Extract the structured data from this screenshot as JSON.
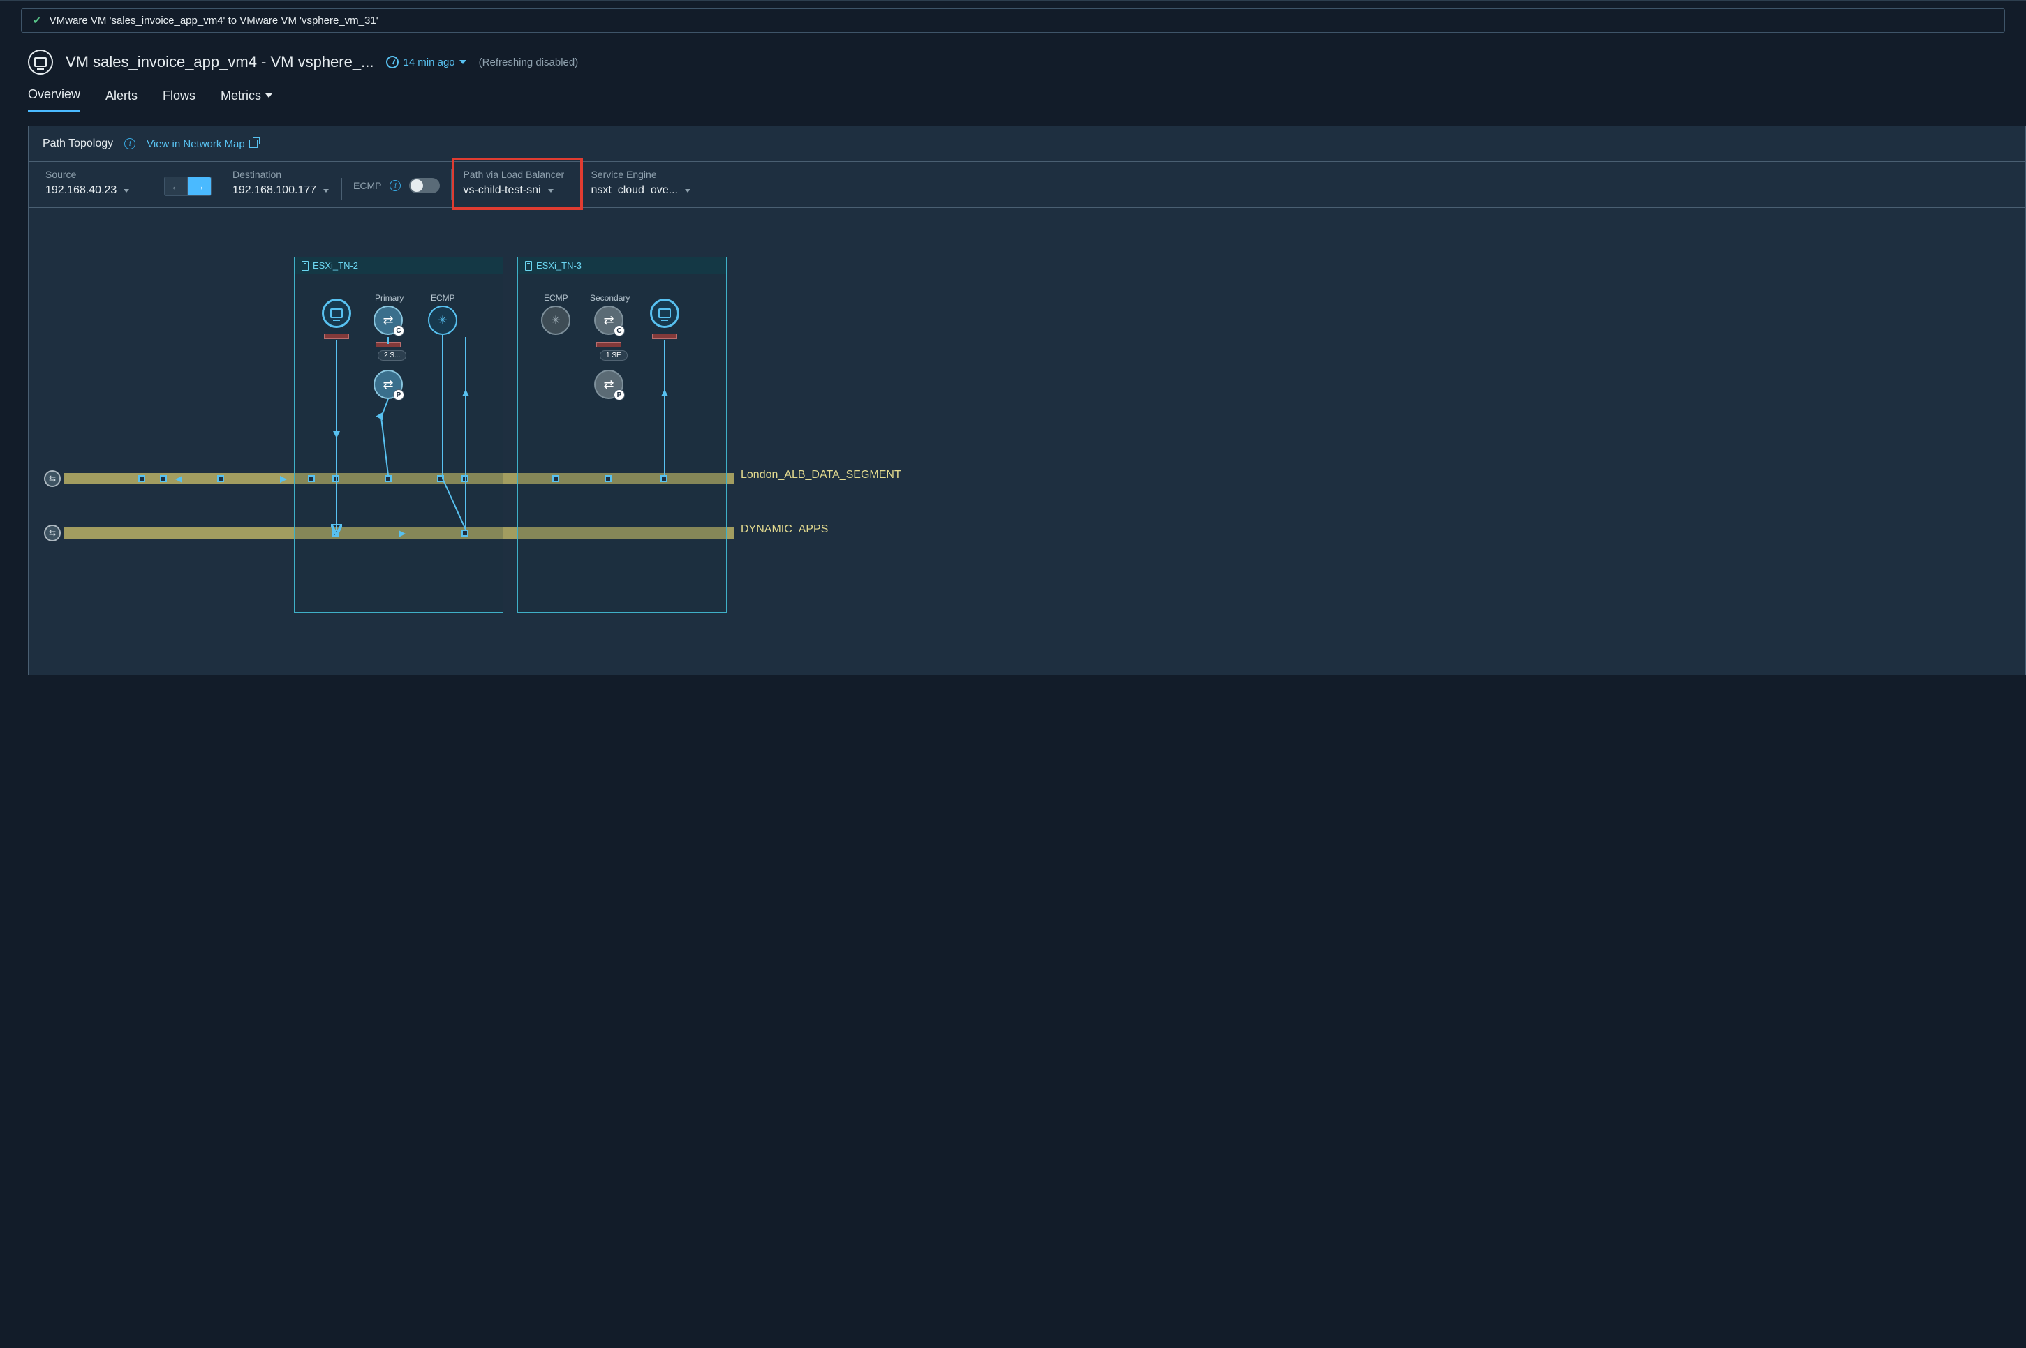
{
  "breadcrumb": "VMware VM 'sales_invoice_app_vm4' to VMware VM 'vsphere_vm_31'",
  "header": {
    "title": "VM sales_invoice_app_vm4 - VM vsphere_...",
    "timestamp": "14 min ago",
    "refresh_status": "(Refreshing disabled)"
  },
  "tabs": {
    "overview": "Overview",
    "alerts": "Alerts",
    "flows": "Flows",
    "metrics": "Metrics"
  },
  "panel": {
    "title": "Path Topology",
    "link": "View in Network Map"
  },
  "filters": {
    "source_label": "Source",
    "source_value": "192.168.40.23",
    "destination_label": "Destination",
    "destination_value": "192.168.100.177",
    "ecmp_label": "ECMP",
    "path_lb_label": "Path via Load Balancer",
    "path_lb_value": "vs-child-test-sni",
    "service_engine_label": "Service Engine",
    "service_engine_value": "nsxt_cloud_ove..."
  },
  "topology": {
    "host1": "ESXi_TN-2",
    "host2": "ESXi_TN-3",
    "primary_label": "Primary",
    "secondary_label": "Secondary",
    "ecmp_label": "ECMP",
    "se_count_1": "2 S...",
    "se_count_2": "1 SE",
    "badge_c": "C",
    "badge_p": "P",
    "segment1": "London_ALB_DATA_SEGMENT",
    "segment2": "DYNAMIC_APPS"
  }
}
